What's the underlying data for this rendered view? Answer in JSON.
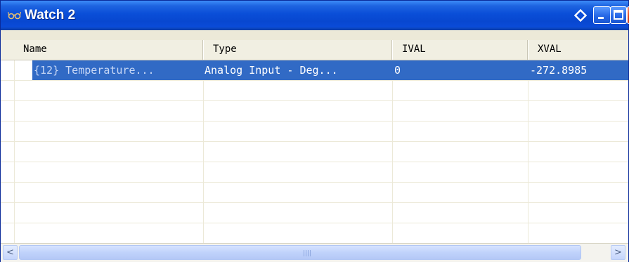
{
  "window": {
    "title": "Watch 2",
    "icons": {
      "app": "glasses-icon",
      "pin": "diamond-icon",
      "minimize": "minimize-icon",
      "maximize": "maximize-icon",
      "close": "close-icon"
    },
    "accent_color": "#0a4ed8",
    "selection_color": "#316ac5"
  },
  "table": {
    "columns": [
      "Name",
      "Type",
      "IVAL",
      "XVAL"
    ],
    "rows": [
      {
        "name": "{12} Temperature...",
        "type": "Analog Input - Deg...",
        "ival": "0",
        "xval": "-272.8985",
        "selected": true
      }
    ]
  },
  "scrollbar": {
    "left_icon": "arrow-left-icon",
    "right_icon": "arrow-right-icon",
    "left_glyph": "<",
    "right_glyph": ">"
  }
}
